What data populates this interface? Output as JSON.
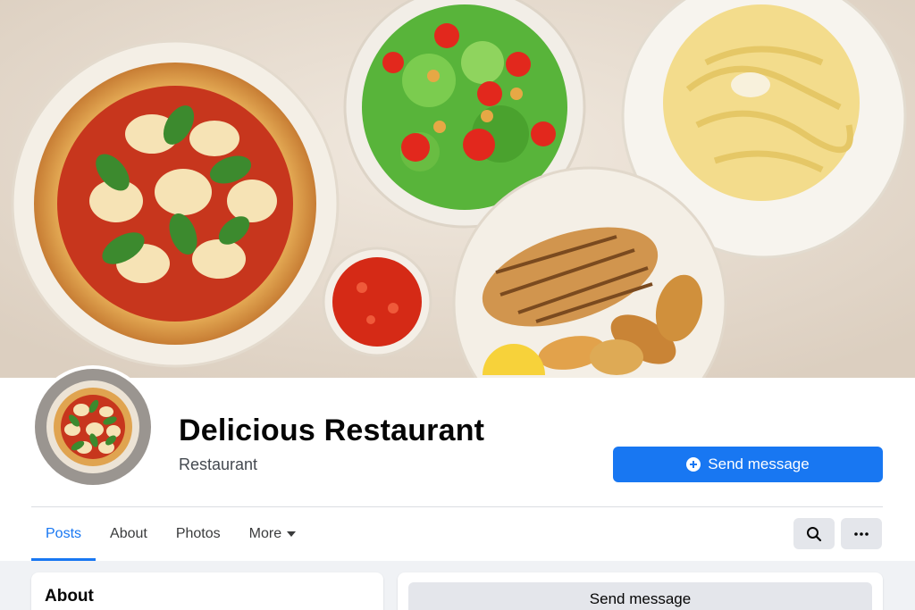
{
  "profile": {
    "name": "Delicious Restaurant",
    "category": "Restaurant"
  },
  "actions": {
    "send_message_label": "Send message",
    "secondary_send_label": "Send message"
  },
  "tabs": [
    {
      "label": "Posts",
      "active": true
    },
    {
      "label": "About",
      "active": false
    },
    {
      "label": "Photos",
      "active": false
    },
    {
      "label": "More",
      "active": false
    }
  ],
  "toolbar": {
    "search_icon": "search-icon",
    "more_icon": "more-options-icon"
  },
  "sections": {
    "about_title": "About"
  },
  "colors": {
    "accent": "#1877f2",
    "cover_bg": "#ece3d8"
  }
}
